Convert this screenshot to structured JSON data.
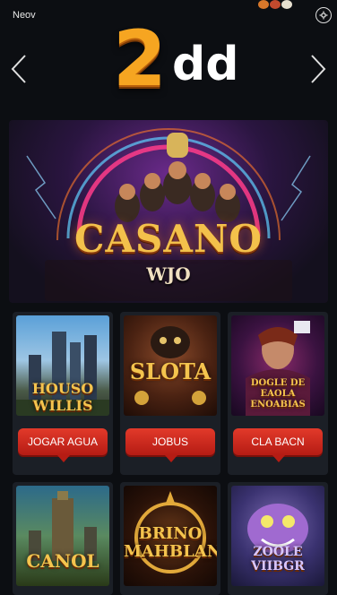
{
  "header": {
    "new_label": "Neov",
    "logo_main": "2",
    "logo_suffix": "dd"
  },
  "banner": {
    "title": "CASANO",
    "subtitle": "WJO"
  },
  "games": [
    {
      "thumb_title": "HOUSO WILLIS",
      "cta_label": "JOGAR AGUA"
    },
    {
      "thumb_title": "SLOTA",
      "cta_label": "JOBUS"
    },
    {
      "thumb_title": "DOGLE DE EAOLA ENOABIAS",
      "cta_label": "CLA BACN"
    },
    {
      "thumb_title": "CANOL"
    },
    {
      "thumb_title": "BRINO MAHBLANT"
    },
    {
      "thumb_title": "ZOOLE VIIBGR"
    }
  ],
  "colors": {
    "background": "#0c0e12",
    "card": "#1b1f26",
    "cta": "#d42b1f",
    "logo_gold": "#f6a521"
  },
  "icons": {
    "settings": "gear-icon",
    "prev": "chevron-left-icon",
    "next": "chevron-right-icon"
  }
}
